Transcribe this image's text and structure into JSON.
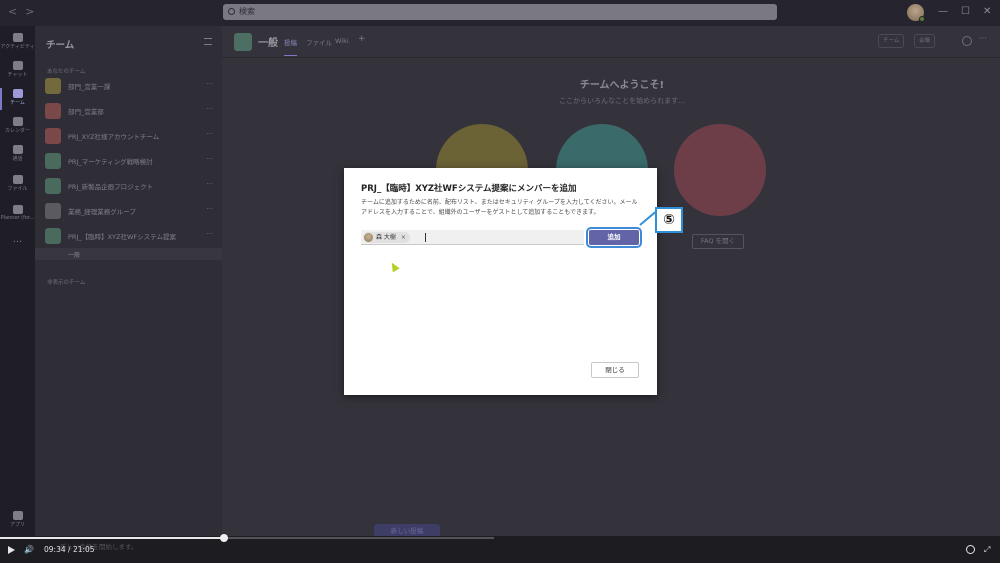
{
  "titlebar": {
    "back": "<",
    "forward": ">",
    "search_placeholder": "検索",
    "minimize": "—",
    "maximize": "☐",
    "close": "✕"
  },
  "rail": {
    "items": [
      {
        "label": "アクティビティ",
        "icon": "bell-icon"
      },
      {
        "label": "チャット",
        "icon": "chat-icon"
      },
      {
        "label": "チーム",
        "icon": "teams-icon",
        "active": true
      },
      {
        "label": "カレンダー",
        "icon": "calendar-icon"
      },
      {
        "label": "通話",
        "icon": "phone-icon"
      },
      {
        "label": "ファイル",
        "icon": "file-icon"
      },
      {
        "label": "Planner (for...",
        "icon": "planner-icon"
      }
    ],
    "more": "...",
    "apps_label": "アプリ"
  },
  "panel": {
    "title": "チーム",
    "your_teams_label": "あなたのチーム",
    "teams": [
      {
        "name": "部門_営業一課",
        "color": "yellow"
      },
      {
        "name": "部門_営業部",
        "color": "red"
      },
      {
        "name": "PRJ_XYZ社様アカウントチーム",
        "color": "red"
      },
      {
        "name": "PRJ_マーケティング戦略検討",
        "color": "teal"
      },
      {
        "name": "PRJ_新製品企画プロジェクト",
        "color": "teal"
      },
      {
        "name": "業務_経理業務グループ",
        "color": "gray"
      },
      {
        "name": "PRJ_【臨時】XYZ社WFシステム提案",
        "color": "teal"
      }
    ],
    "more": "···",
    "active_channel": "一般",
    "hidden_teams_label": "非表示のチーム"
  },
  "main": {
    "channel_title": "一般",
    "tabs": [
      "投稿",
      "ファイル",
      "Wiki"
    ],
    "add_tab": "+",
    "team_btn": "チーム",
    "meeting_btn": "会議",
    "welcome_title": "チームへようこそ!",
    "welcome_sub": "ここからいろんなことを始められます...",
    "faq_button": "FAQ を開く",
    "new_post": "新しい投稿"
  },
  "dialog": {
    "title": "PRJ_【臨時】XYZ社WFシステム提案にメンバーを追加",
    "description": "チームに追加するために名前、配布リスト、またはセキュリティ グループを入力してください。メールアドレスを入力することで、組織外のユーザーをゲストとして追加することもできます。",
    "chip_name": "森 大樹",
    "chip_remove": "×",
    "add_button": "追加",
    "close_button": "閉じる"
  },
  "callout": {
    "label": "⑤"
  },
  "video": {
    "current": "09:34",
    "separator": "/",
    "total": "21:05",
    "progress": 0.454,
    "volume_icon": "🔊",
    "fullscreen_icon": "⤢"
  },
  "under_text": "新しい会話を開始します。"
}
